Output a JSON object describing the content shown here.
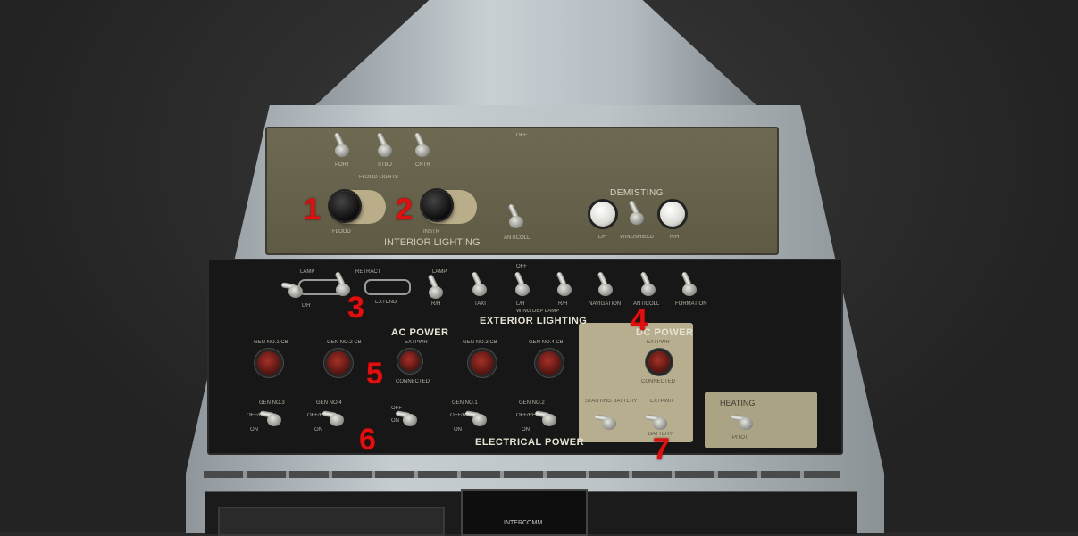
{
  "interior_panel": {
    "top_label": "OFF",
    "switch_labels": [
      "PORT",
      "STBD",
      "CNTR"
    ],
    "sub_label": "FLOOD LIGHTS",
    "knob_labels": [
      "FLOOD",
      "INSTR"
    ],
    "toggle_label": "ANTICOLL",
    "demisting_title": "DEMISTING",
    "demisting_labels": [
      "L/H",
      "WINDSHIELD",
      "R/H"
    ],
    "title": "INTERIOR LIGHTING"
  },
  "exterior_panel": {
    "top_label": "OFF",
    "group_labels": [
      "LAMP",
      "RETRACT",
      "LAMP"
    ],
    "extend_label": "EXTEND",
    "switch_labels": [
      "L/H",
      "R/H",
      "TAXI",
      "L/H",
      "R/H",
      "NAVIGATION",
      "ANTICOLL",
      "FORMATION"
    ],
    "wing_label": "WING DEP LAMP",
    "title": "EXTERIOR LIGHTING"
  },
  "ac_power": {
    "title": "AC POWER",
    "ext_label": "EXTPWR",
    "connected_label": "CONNECTED",
    "lamp_labels": [
      "GEN NO.1 CB",
      "GEN NO.2 CB",
      "GEN NO.3 CB",
      "GEN NO.4 CB"
    ]
  },
  "electrical_power": {
    "title": "ELECTRICAL POWER",
    "switch_labels": [
      "GEN NO.3",
      "GEN NO.4",
      "GEN NO.1",
      "GEN NO.2"
    ],
    "off_label": "OFF/RESET",
    "on_label": "ON",
    "off_label_short": "OFF"
  },
  "dc_power": {
    "title": "DC POWER",
    "ext_label": "EXTPWR",
    "connected_label": "CONNECTED",
    "switch_labels": [
      "STARTING BATTERY",
      "EXTPWR"
    ],
    "battery_label": "BATTERY"
  },
  "heating": {
    "title": "HEATING",
    "sub_label": "PITOT"
  },
  "bottom": {
    "intercomm_label": "INTERCOMM"
  },
  "callouts": [
    "1",
    "2",
    "3",
    "4",
    "5",
    "6",
    "7"
  ]
}
